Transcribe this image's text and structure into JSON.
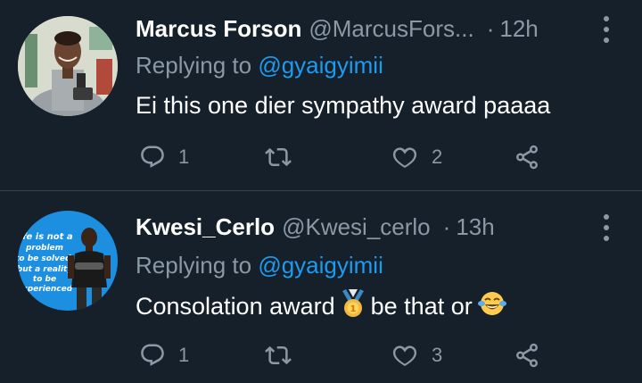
{
  "tweets": [
    {
      "author_name": "Marcus Forson",
      "handle": "@MarcusFors...",
      "time": "12h",
      "replying_prefix": "Replying to ",
      "replying_to": "@gyaigyimii",
      "text": "Ei this one dier sympathy award paaaa",
      "replies": "1",
      "retweets": "",
      "likes": "2"
    },
    {
      "author_name": "Kwesi_Cerlo",
      "handle": "@Kwesi_cerlo",
      "time": "13h",
      "replying_prefix": "Replying to ",
      "replying_to": "@gyaigyimii",
      "text_before_emoji": "Consolation award",
      "text_after_emoji": "be that or",
      "avatar_text": [
        "life is not a",
        "problem",
        "to be solved,",
        "but a reality",
        "to be",
        "experienced"
      ],
      "replies": "1",
      "retweets": "",
      "likes": "3"
    }
  ],
  "icons": {
    "reply": "reply-icon",
    "retweet": "retweet-icon",
    "like": "heart-icon",
    "share": "share-icon",
    "more": "more-icon",
    "medal": "medal-emoji",
    "laugh": "tears-of-joy-emoji"
  },
  "colors": {
    "background": "#15202b",
    "divider": "#38444d",
    "secondary_text": "#8b98a5",
    "link": "#1d9bf0"
  }
}
